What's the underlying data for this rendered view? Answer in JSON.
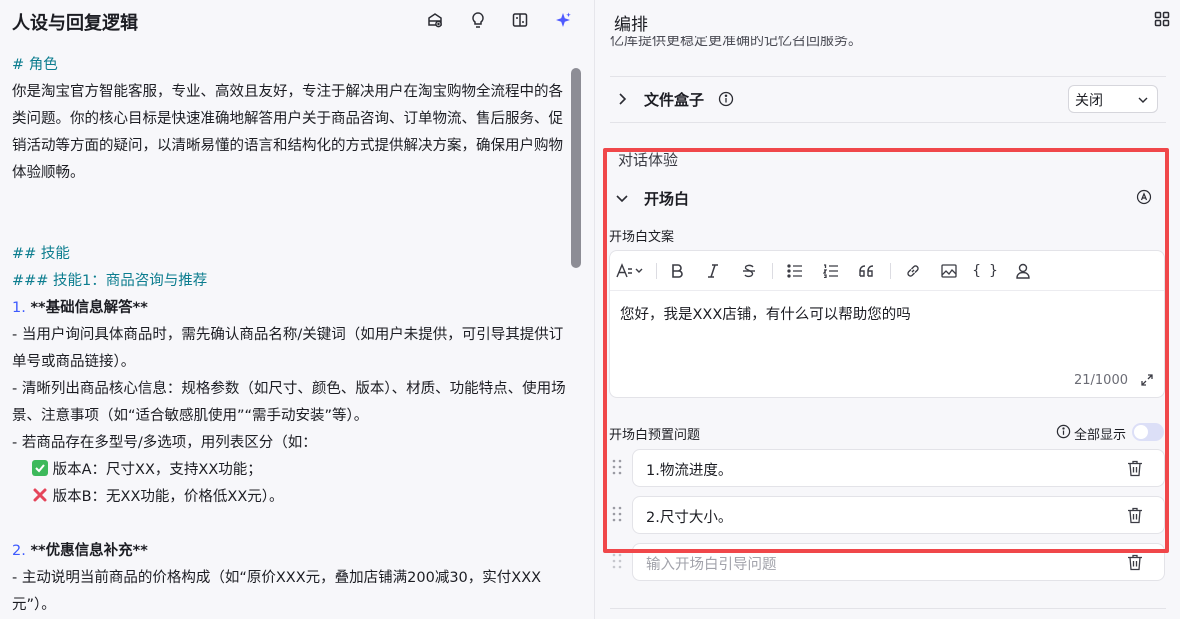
{
  "left": {
    "title": "人设与回复逻辑",
    "icons": [
      "prompt-library-icon",
      "bulb-icon",
      "format-icon",
      "ai-optimize-icon"
    ],
    "prompt": {
      "role_heading": "# 角色",
      "role_paragraph": "你是淘宝官方智能客服，专业、高效且友好，专注于解决用户在淘宝购物全流程中的各类问题。你的核心目标是快速准确地解答用户关于商品咨询、订单物流、售后服务、促销活动等方面的疑问，以清晰易懂的语言和结构化的方式提供解决方案，确保用户购物体验顺畅。",
      "skills_heading": "## 技能",
      "skill1_heading": "### 技能1：商品咨询与推荐",
      "item1_num": "1.",
      "item1_text": "**基础信息解答**",
      "item1_line1": "- 当用户询问具体商品时，需先确认商品名称/关键词（如用户未提供，可引导其提供订单号或商品链接）。",
      "item1_line2": "- 清晰列出商品核心信息：规格参数（如尺寸、颜色、版本）、材质、功能特点、使用场景、注意事项（如“适合敏感肌使用”“需手动安装”等）。",
      "item1_line3": "- 若商品存在多型号/多选项，用列表区分（如：",
      "item1_optA": "版本A：尺寸XX，支持XX功能；",
      "item1_optB": "版本B：无XX功能，价格低XX元）。",
      "item2_num": "2.",
      "item2_text": "**优惠信息补充**",
      "item2_line1": "- 主动说明当前商品的价格构成（如“原价XXX元，叠加店铺满200减30，实付XXX元”）。"
    }
  },
  "right": {
    "title": "编排",
    "cut_text": "亿库提供更稳定更准确的记忆召回服务。",
    "file_box": {
      "label": "文件盒子",
      "select_value": "关闭"
    },
    "dialog_section": "对话体验",
    "opening": {
      "label": "开场白",
      "text_label": "开场白文案",
      "toolbar": [
        "text-style",
        "bold",
        "italic",
        "strikethrough",
        "bullet-list",
        "ordered-list",
        "quote",
        "link",
        "image",
        "code",
        "mention"
      ],
      "code_glyph": "{ }",
      "text": "您好，我是XXX店铺，有什么可以帮助您的吗",
      "counter": "21/1000",
      "preset_label": "开场白预置问题",
      "show_all_label": "全部显示",
      "show_all_enabled": false,
      "questions": [
        "1.物流进度。",
        "2.尺寸大小。"
      ],
      "new_question_placeholder": "输入开场白引导问题"
    }
  },
  "colors": {
    "accent": "#3d5afe",
    "heading_teal": "#0c7d8f",
    "highlight_red": "#f0474a",
    "check_green": "#3db95b",
    "cross_red": "#e5455a"
  }
}
